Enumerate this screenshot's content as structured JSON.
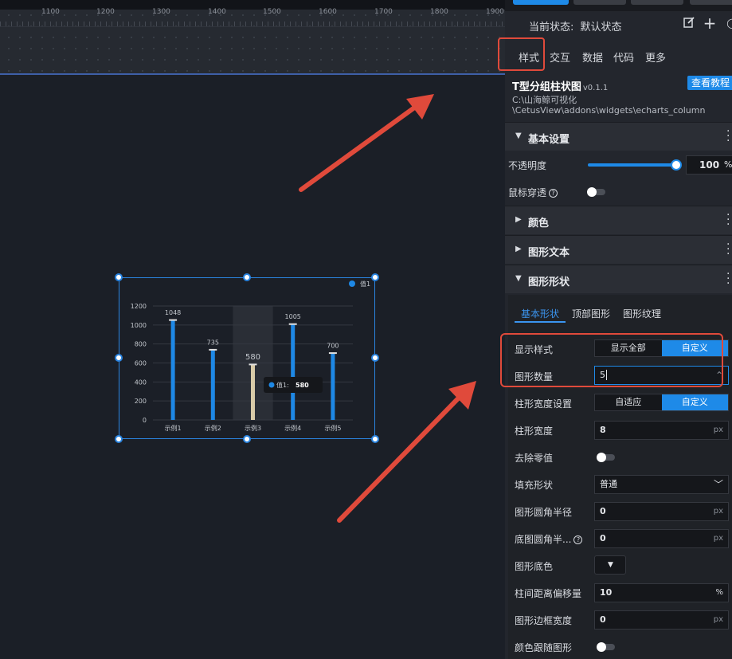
{
  "canvas": {
    "ruler_ticks": [
      "1100",
      "1200",
      "1300",
      "1400",
      "1500",
      "1600",
      "1700",
      "1800",
      "1900"
    ]
  },
  "chart": {
    "legend": "值1",
    "tooltip_label": "值1:",
    "tooltip_value": "580",
    "highlight_value": "580"
  },
  "chart_data": {
    "type": "bar",
    "categories": [
      "示例1",
      "示例2",
      "示例3",
      "示例4",
      "示例5"
    ],
    "series": [
      {
        "name": "值1",
        "values": [
          1048,
          735,
          580,
          1005,
          700
        ]
      }
    ],
    "yticks": [
      "0",
      "200",
      "400",
      "600",
      "800",
      "1000",
      "1200"
    ],
    "ylim": [
      0,
      1200
    ],
    "colors": {
      "bar": "#1e88e5",
      "hover_bar": "#d9cba8",
      "cap": "#e0e0e0"
    },
    "grid": true,
    "legend_position": "top-right"
  },
  "panel": {
    "state_label": "当前状态:",
    "state_value": "默认状态",
    "tabs": [
      "样式",
      "交互",
      "数据",
      "代码",
      "更多"
    ],
    "component_title": "T型分组柱状图",
    "component_version": "v0.1.1",
    "help_button": "查看教程",
    "path_line1": "C:\\山海鲸可视化",
    "path_line2": "\\CetusView\\addons\\widgets\\echarts_column",
    "sections": {
      "basic": "基本设置",
      "color": "颜色",
      "shape_text": "图形文本",
      "shape_form": "图形形状"
    },
    "opacity_label": "不透明度",
    "opacity_value": "100",
    "opacity_unit": "%",
    "mouse_through_label": "鼠标穿透",
    "subtabs": [
      "基本形状",
      "顶部图形",
      "图形纹理"
    ],
    "display_style_label": "显示样式",
    "display_style_options": [
      "显示全部",
      "自定义"
    ],
    "shape_count_label": "图形数量",
    "shape_count_value": "5",
    "bar_width_setting_label": "柱形宽度设置",
    "bar_width_setting_options": [
      "自适应",
      "自定义"
    ],
    "bar_width_label": "柱形宽度",
    "bar_width_value": "8",
    "remove_zero_label": "去除零值",
    "fill_shape_label": "填充形状",
    "fill_shape_value": "普通",
    "corner_radius_label": "图形圆角半径",
    "corner_radius_value": "0",
    "base_radius_label": "底图圆角半...",
    "base_radius_value": "0",
    "base_color_label": "图形底色",
    "gap_offset_label": "柱间距离偏移量",
    "gap_offset_value": "10",
    "gap_offset_unit": "%",
    "border_width_label": "图形边框宽度",
    "border_width_value": "0",
    "follow_color_label": "颜色跟随图形",
    "unit_px": "px"
  },
  "colors": {
    "accent": "#1e8ae8",
    "annotation_red": "#e04a3b",
    "panel_bg": "#23262d",
    "canvas_bg": "#1b1f27"
  }
}
